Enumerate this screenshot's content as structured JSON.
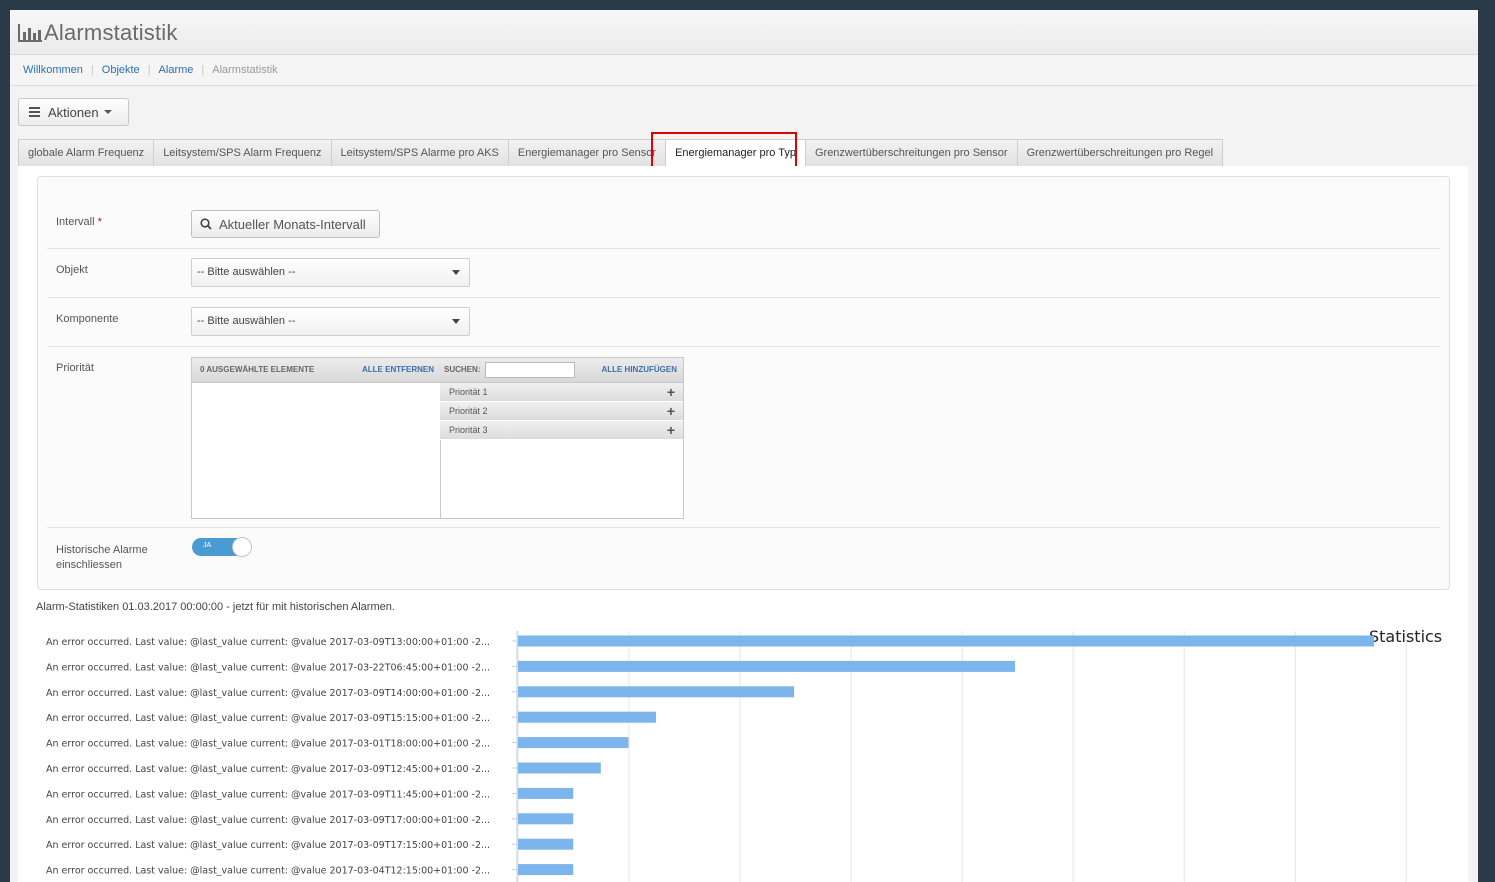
{
  "app": {
    "title": "Alarmstatistik"
  },
  "breadcrumbs": [
    {
      "label": "Willkommen"
    },
    {
      "label": "Objekte"
    },
    {
      "label": "Alarme"
    },
    {
      "label": "Alarmstatistik"
    }
  ],
  "actions_button": {
    "label": "Aktionen"
  },
  "tabs": [
    {
      "label": "globale Alarm Frequenz"
    },
    {
      "label": "Leitsystem/SPS Alarm Frequenz"
    },
    {
      "label": "Leitsystem/SPS Alarme pro AKS"
    },
    {
      "label": "Energiemanager pro Sensor"
    },
    {
      "label": "Energiemanager pro Typ"
    },
    {
      "label": "Grenzwertüberschreitungen pro Sensor"
    },
    {
      "label": "Grenzwertüberschreitungen pro Regel"
    }
  ],
  "active_tab": "Energiemanager pro Typ",
  "form": {
    "interval": {
      "label": "Intervall",
      "required_mark": "*",
      "button_label": "Aktueller Monats-Intervall"
    },
    "object": {
      "label": "Objekt",
      "value": "-- Bitte auswählen --"
    },
    "component": {
      "label": "Komponente",
      "value": "-- Bitte auswählen --"
    },
    "priority": {
      "label": "Priorität",
      "selected_header": "0 AUSGEWÄHLTE ELEMENTE",
      "remove_all": "ALLE ENTFERNEN",
      "search_label": "SUCHEN:",
      "add_all": "ALLE HINZUFÜGEN",
      "available": [
        "Priorität 1",
        "Priorität 2",
        "Priorität 3"
      ]
    },
    "historic": {
      "label_line1": "Historische Alarme",
      "label_line2": "einschliessen",
      "toggle_text": "JA",
      "toggle_on": true
    }
  },
  "caption": "Alarm-Statistiken 01.03.2017 00:00:00 - jetzt für mit historischen Alarmen.",
  "colors": {
    "bar": "#7cb5ec",
    "accent": "#4a9ad4",
    "link": "#2a6fb3",
    "highlight": "#e00000"
  },
  "chart_data": {
    "type": "bar",
    "orientation": "horizontal",
    "title": "Statistics",
    "xlim": [
      0,
      31
    ],
    "grid": true,
    "categories": [
      "An error occurred. Last value: @last_value current: @value 2017-03-09T13:00:00+01:00 -2...",
      "An error occurred. Last value: @last_value current: @value 2017-03-22T06:45:00+01:00 -2...",
      "An error occurred. Last value: @last_value current: @value 2017-03-09T14:00:00+01:00 -2...",
      "An error occurred. Last value: @last_value current: @value 2017-03-09T15:15:00+01:00 -2...",
      "An error occurred. Last value: @last_value current: @value 2017-03-01T18:00:00+01:00 -2...",
      "An error occurred. Last value: @last_value current: @value 2017-03-09T12:45:00+01:00 -2...",
      "An error occurred. Last value: @last_value current: @value 2017-03-09T11:45:00+01:00 -2...",
      "An error occurred. Last value: @last_value current: @value 2017-03-09T17:00:00+01:00 -2...",
      "An error occurred. Last value: @last_value current: @value 2017-03-09T17:15:00+01:00 -2...",
      "An error occurred. Last value: @last_value current: @value 2017-03-04T12:15:00+01:00 -2..."
    ],
    "values": [
      31,
      18,
      10,
      5,
      4,
      3,
      2,
      2,
      2,
      2
    ]
  }
}
